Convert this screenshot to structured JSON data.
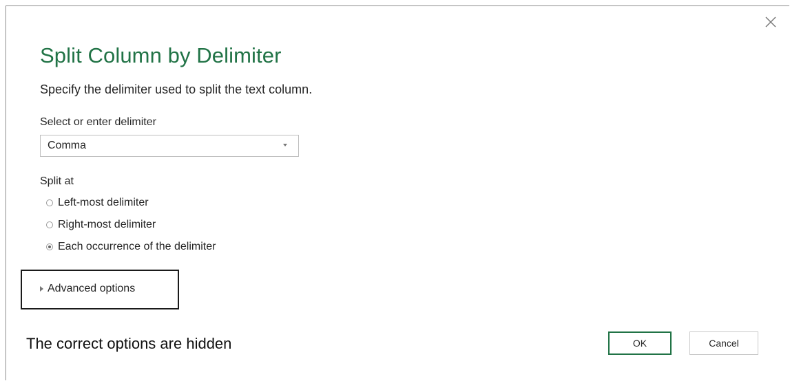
{
  "dialog": {
    "title": "Split Column by Delimiter",
    "subtitle": "Specify the delimiter used to split the text column.",
    "close_icon": "close-icon"
  },
  "delimiter": {
    "label": "Select or enter delimiter",
    "value": "Comma"
  },
  "split_at": {
    "label": "Split at",
    "options": [
      {
        "label": "Left-most delimiter",
        "checked": false
      },
      {
        "label": "Right-most delimiter",
        "checked": false
      },
      {
        "label": "Each occurrence of the delimiter",
        "checked": true
      }
    ]
  },
  "advanced": {
    "label": "Advanced options",
    "icon": "expand-triangle-icon"
  },
  "annotation": "The correct options are hidden",
  "buttons": {
    "ok": "OK",
    "cancel": "Cancel"
  },
  "colors": {
    "accent": "#217346",
    "highlight_box": "#1a1a1a"
  }
}
